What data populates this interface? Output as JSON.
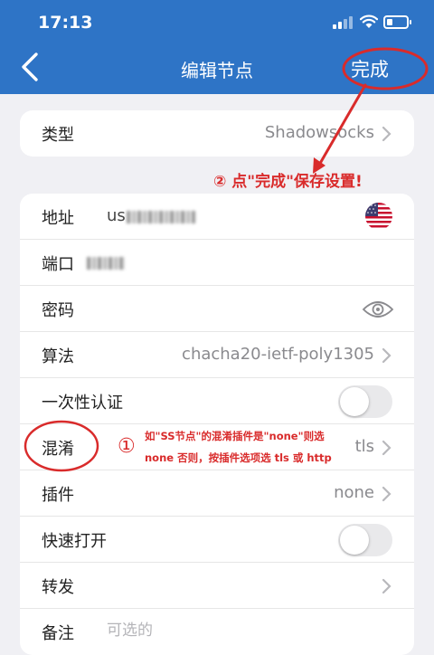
{
  "status_bar": {
    "time": "17:13"
  },
  "nav": {
    "title": "编辑节点",
    "done_label": "完成"
  },
  "card_type": {
    "label": "类型",
    "value": "Shadowsocks"
  },
  "card_main": {
    "address": {
      "label": "地址",
      "value_prefix": "us"
    },
    "port": {
      "label": "端口"
    },
    "password": {
      "label": "密码"
    },
    "algorithm": {
      "label": "算法",
      "value": "chacha20-ietf-poly1305"
    },
    "ota": {
      "label": "一次性认证",
      "enabled": false
    },
    "obfs": {
      "label": "混淆",
      "value": "tls"
    },
    "plugin": {
      "label": "插件",
      "value": "none"
    },
    "fast_open": {
      "label": "快速打开",
      "enabled": false
    },
    "forward": {
      "label": "转发"
    },
    "note": {
      "label": "备注",
      "placeholder": "可选的"
    }
  },
  "annotations": {
    "save": "② 点\"完成\"保存设置!",
    "obfs_marker": "①",
    "obfs_line1": "如\"SS节点\"的混淆插件是\"none\"则选",
    "obfs_line2": "none 否则，按插件选项选 tls 或 http"
  },
  "colors": {
    "header_bg": "#2e74c6",
    "annotation_red": "#d92b2b",
    "page_bg": "#f0f0f4"
  }
}
